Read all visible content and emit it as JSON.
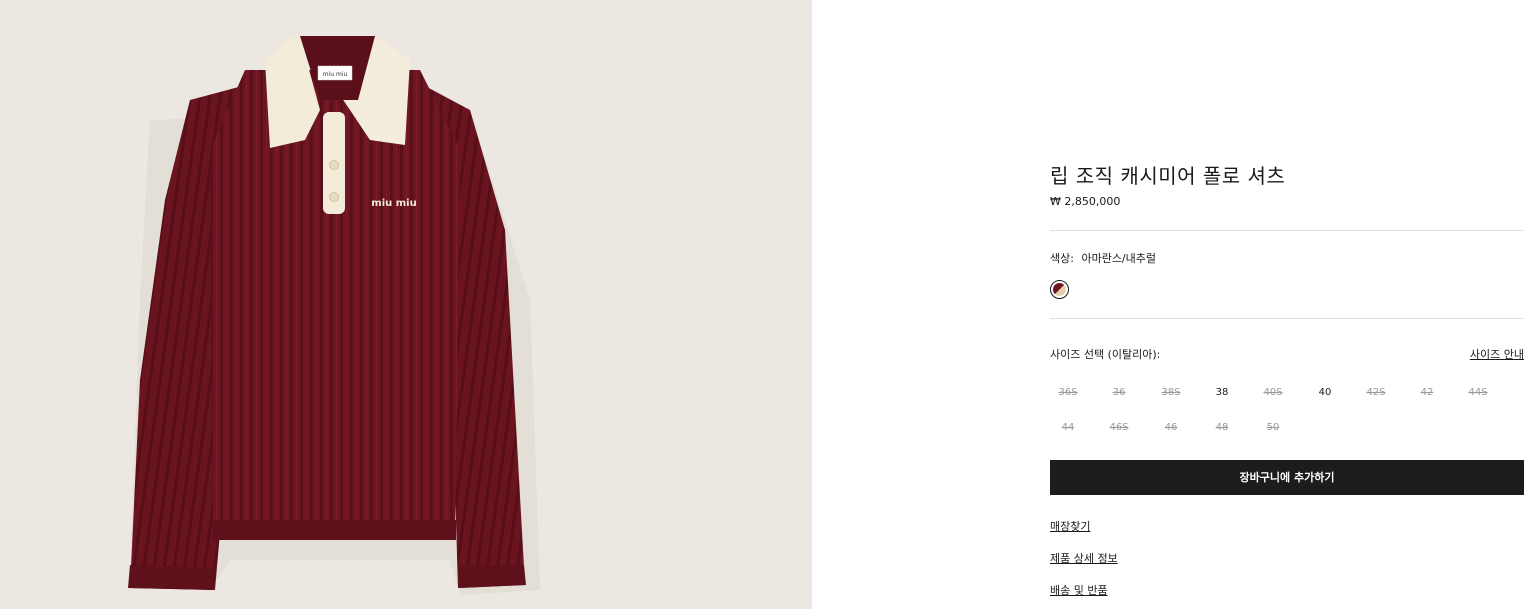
{
  "product": {
    "image_alt": "Ribbed cashmere polo shirt in amaranth with natural collar",
    "brand_mark": "miu miu",
    "title": "립 조직 캐시미어 폴로 셔츠",
    "price": "₩ 2,850,000"
  },
  "color": {
    "label": "색상:",
    "value": "아마란스/내추럴",
    "swatches": [
      {
        "name": "아마란스/내추럴",
        "primary": "#6e1522",
        "secondary": "#e8cfae",
        "selected": true
      }
    ]
  },
  "size": {
    "label": "사이즈 선택 (이탈리아):",
    "guide_label": "사이즈 안내",
    "options": [
      {
        "label": "36S",
        "available": false
      },
      {
        "label": "36",
        "available": false
      },
      {
        "label": "38S",
        "available": false
      },
      {
        "label": "38",
        "available": true
      },
      {
        "label": "40S",
        "available": false
      },
      {
        "label": "40",
        "available": true
      },
      {
        "label": "42S",
        "available": false
      },
      {
        "label": "42",
        "available": false
      },
      {
        "label": "44S",
        "available": false
      },
      {
        "label": "44",
        "available": false
      },
      {
        "label": "46S",
        "available": false
      },
      {
        "label": "46",
        "available": false
      },
      {
        "label": "48",
        "available": false
      },
      {
        "label": "50",
        "available": false
      }
    ]
  },
  "cart": {
    "label": "장바구니에 추가하기"
  },
  "links": {
    "store": "매장찾기",
    "details": "제품 상세 정보",
    "shipping": "배송 및 반품"
  },
  "colors": {
    "background_image": "#ece7e1",
    "sweater": "#6e1522",
    "collar": "#f3ecd9",
    "button_dark": "#1c1c1c"
  }
}
